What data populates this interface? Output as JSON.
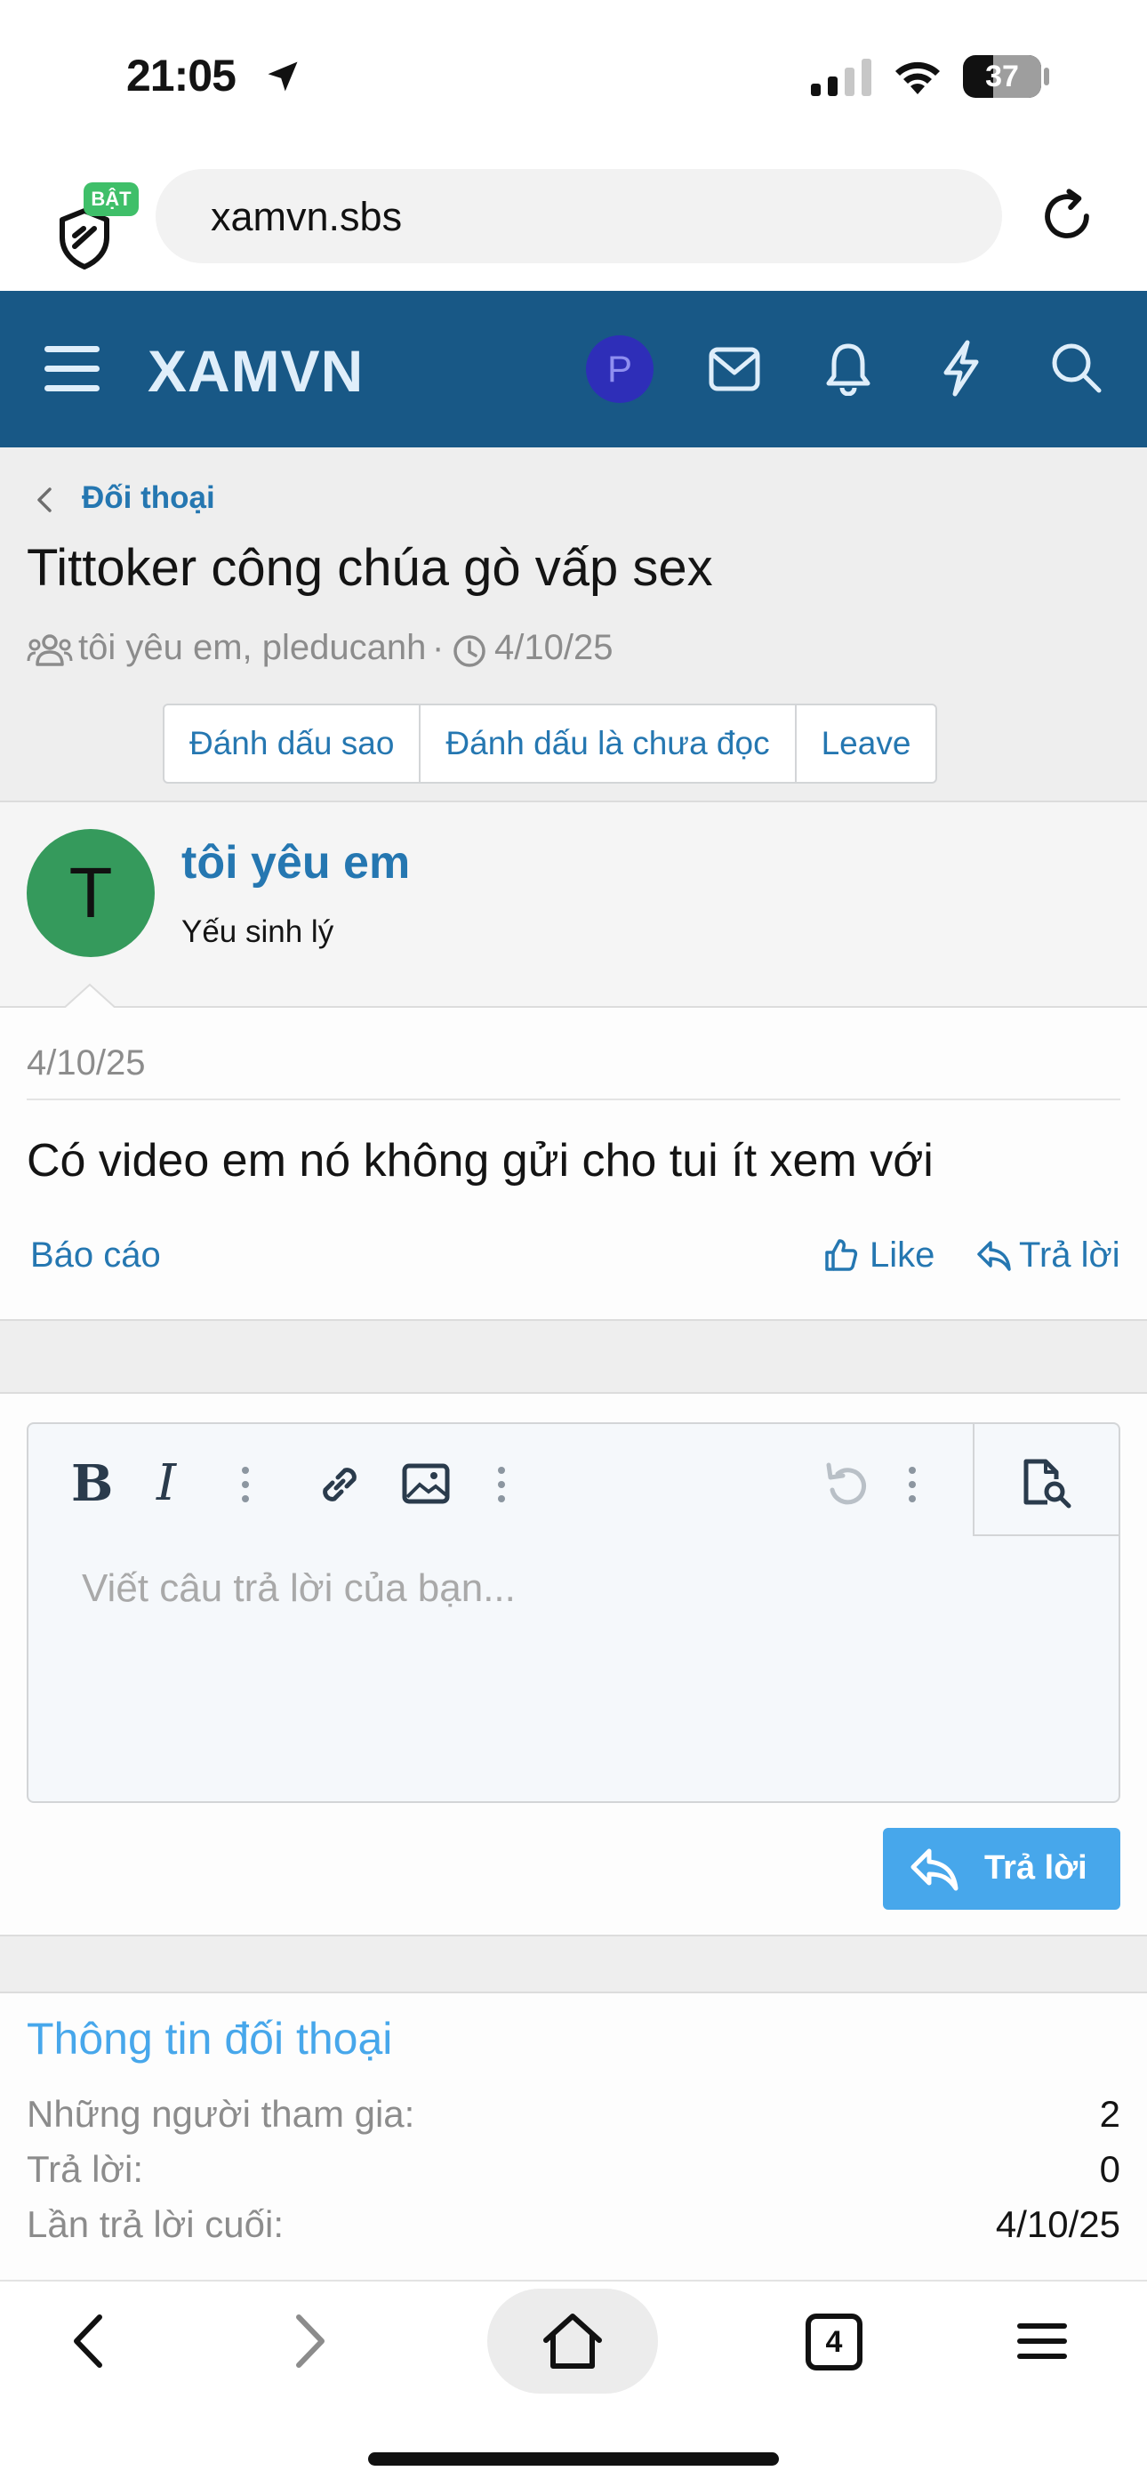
{
  "status_bar": {
    "time": "21:05",
    "battery": "37"
  },
  "browser": {
    "shield_badge": "BẬT",
    "url": "xamvn.sbs"
  },
  "forum": {
    "logo": "XAMVN",
    "avatar_letter": "P",
    "accent": "#185886"
  },
  "thread": {
    "breadcrumb": "Đối thoại",
    "title": "Tittoker công chúa gò vấp sex",
    "participants": "tôi yêu em, pleducanh",
    "separator": "·",
    "date": "4/10/25",
    "buttons": [
      "Đánh dấu sao",
      "Đánh dấu là chưa đọc",
      "Leave"
    ]
  },
  "message": {
    "avatar_letter": "T",
    "avatar_color": "#359a5c",
    "username": "tôi yêu em",
    "user_title": "Yếu sinh lý",
    "date": "4/10/25",
    "text": "Có video em nó không gửi cho tui ít xem với",
    "report": "Báo cáo",
    "like": "Like",
    "reply": "Trả lời"
  },
  "editor": {
    "placeholder": "Viết câu trả lời của bạn...",
    "submit_label": "Trả lời"
  },
  "info": {
    "title": "Thông tin đối thoại",
    "rows": [
      {
        "label": "Những người tham gia:",
        "value": "2"
      },
      {
        "label": "Trả lời:",
        "value": "0"
      },
      {
        "label": "Lần trả lời cuối:",
        "value": "4/10/25"
      }
    ]
  },
  "toolbar": {
    "tabs_count": "4"
  }
}
